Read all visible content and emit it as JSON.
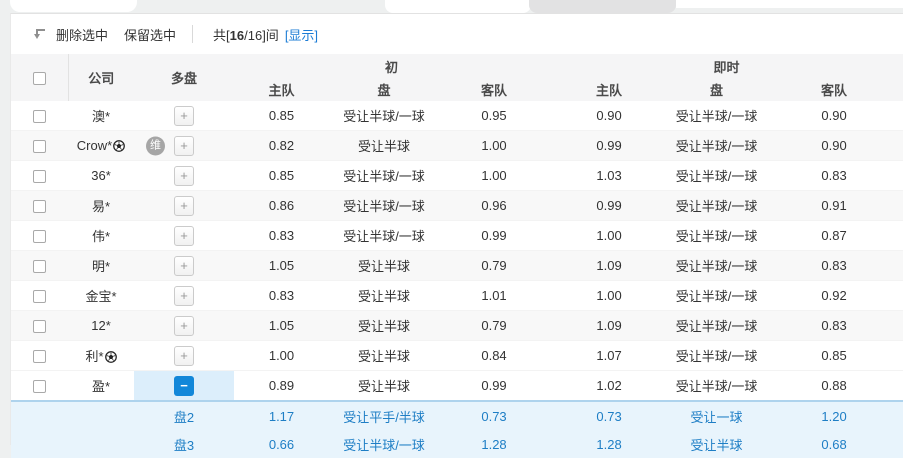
{
  "colors": {
    "link_blue": "#1c7cd5",
    "collapse_button_blue": "#1287d9",
    "expanded_row_bg": "#e8f4fc",
    "expanded_row_text": "#1e7ec5",
    "badge_gray": "#a6a6a6"
  },
  "toolbar": {
    "move_icon": "return-arrow-icon",
    "delete_button": "删除选中",
    "keep_button": "保留选中",
    "count_prefix": "共[",
    "count_selected": "16",
    "count_rest": "/16]间",
    "show_link": "[显示]"
  },
  "table": {
    "headers": {
      "company": "公司",
      "multi": "多盘",
      "initial_group": "初",
      "live_group": "即时",
      "home": "主队",
      "handicap": "盘",
      "away": "客队"
    },
    "buttons": {
      "expand": "+",
      "collapse": "−"
    },
    "rows": [
      {
        "company": "澳*",
        "has_ball": false,
        "badge": "",
        "expanded": false,
        "initial": {
          "home": "0.85",
          "handicap": "受让半球/一球",
          "away": "0.95"
        },
        "live": {
          "home": "0.90",
          "handicap": "受让半球/一球",
          "away": "0.90"
        }
      },
      {
        "company": "Crow*",
        "has_ball": true,
        "badge": "维",
        "expanded": false,
        "initial": {
          "home": "0.82",
          "handicap": "受让半球",
          "away": "1.00"
        },
        "live": {
          "home": "0.99",
          "handicap": "受让半球/一球",
          "away": "0.90"
        }
      },
      {
        "company": "36*",
        "has_ball": false,
        "badge": "",
        "expanded": false,
        "initial": {
          "home": "0.85",
          "handicap": "受让半球/一球",
          "away": "1.00"
        },
        "live": {
          "home": "1.03",
          "handicap": "受让半球/一球",
          "away": "0.83"
        }
      },
      {
        "company": "易*",
        "has_ball": false,
        "badge": "",
        "expanded": false,
        "initial": {
          "home": "0.86",
          "handicap": "受让半球/一球",
          "away": "0.96"
        },
        "live": {
          "home": "0.99",
          "handicap": "受让半球/一球",
          "away": "0.91"
        }
      },
      {
        "company": "伟*",
        "has_ball": false,
        "badge": "",
        "expanded": false,
        "initial": {
          "home": "0.83",
          "handicap": "受让半球/一球",
          "away": "0.99"
        },
        "live": {
          "home": "1.00",
          "handicap": "受让半球/一球",
          "away": "0.87"
        }
      },
      {
        "company": "明*",
        "has_ball": false,
        "badge": "",
        "expanded": false,
        "initial": {
          "home": "1.05",
          "handicap": "受让半球",
          "away": "0.79"
        },
        "live": {
          "home": "1.09",
          "handicap": "受让半球/一球",
          "away": "0.83"
        }
      },
      {
        "company": "金宝*",
        "has_ball": false,
        "badge": "",
        "expanded": false,
        "initial": {
          "home": "0.83",
          "handicap": "受让半球",
          "away": "1.01"
        },
        "live": {
          "home": "1.00",
          "handicap": "受让半球/一球",
          "away": "0.92"
        }
      },
      {
        "company": "12*",
        "has_ball": false,
        "badge": "",
        "expanded": false,
        "initial": {
          "home": "1.05",
          "handicap": "受让半球",
          "away": "0.79"
        },
        "live": {
          "home": "1.09",
          "handicap": "受让半球/一球",
          "away": "0.83"
        }
      },
      {
        "company": "利*",
        "has_ball": true,
        "badge": "",
        "expanded": false,
        "initial": {
          "home": "1.00",
          "handicap": "受让半球",
          "away": "0.84"
        },
        "live": {
          "home": "1.07",
          "handicap": "受让半球/一球",
          "away": "0.85"
        }
      },
      {
        "company": "盈*",
        "has_ball": false,
        "badge": "",
        "expanded": true,
        "initial": {
          "home": "0.89",
          "handicap": "受让半球",
          "away": "0.99"
        },
        "live": {
          "home": "1.02",
          "handicap": "受让半球/一球",
          "away": "0.88"
        }
      }
    ],
    "expanded_rows": [
      {
        "label": "盘2",
        "initial": {
          "home": "1.17",
          "handicap": "受让平手/半球",
          "away": "0.73"
        },
        "live": {
          "home": "0.73",
          "handicap": "受让一球",
          "away": "1.20"
        }
      },
      {
        "label": "盘3",
        "initial": {
          "home": "0.66",
          "handicap": "受让半球/一球",
          "away": "1.28"
        },
        "live": {
          "home": "1.28",
          "handicap": "受让半球",
          "away": "0.68"
        }
      }
    ]
  }
}
